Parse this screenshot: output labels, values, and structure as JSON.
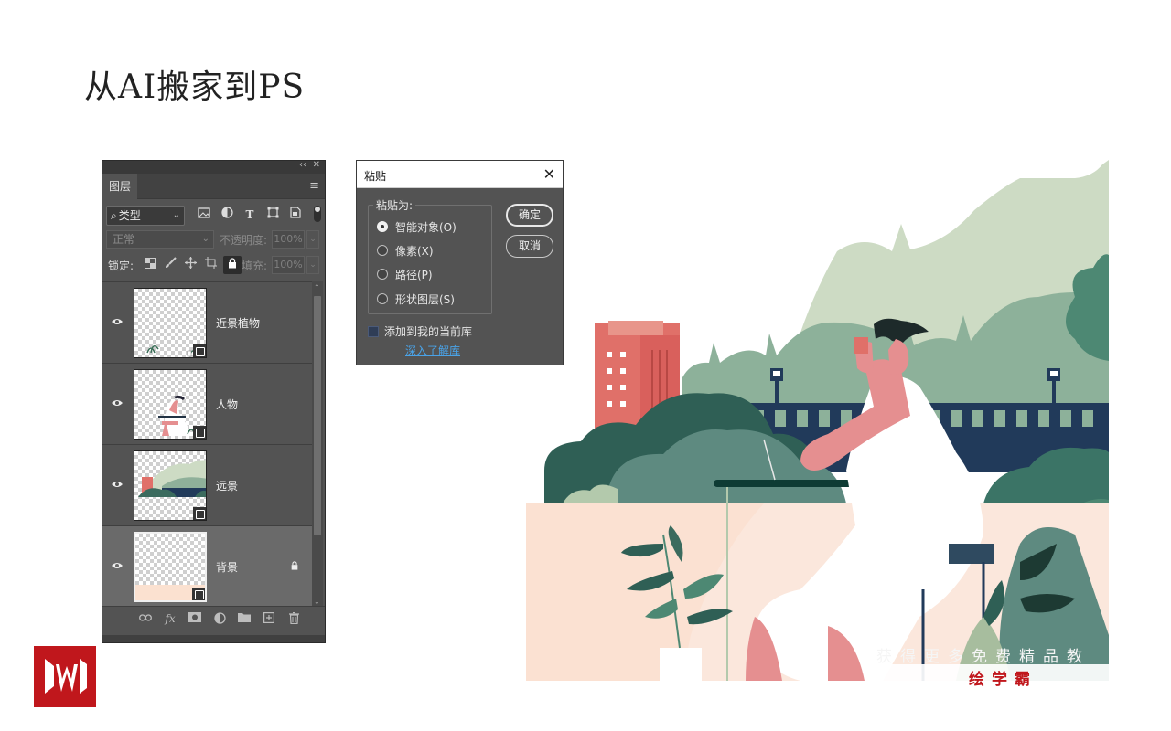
{
  "slide": {
    "title": "从AI搬家到PS"
  },
  "layers_panel": {
    "tab": "图层",
    "filter": {
      "label": "类型"
    },
    "blend_mode": "正常",
    "opacity": {
      "label": "不透明度:",
      "value": "100%"
    },
    "lock": {
      "label": "锁定:"
    },
    "fill": {
      "label": "填充:",
      "value": "100%"
    },
    "layers": [
      {
        "name": "近景植物",
        "visible": true,
        "locked": false,
        "selected": false
      },
      {
        "name": "人物",
        "visible": true,
        "locked": false,
        "selected": false
      },
      {
        "name": "远景",
        "visible": true,
        "locked": false,
        "selected": false
      },
      {
        "name": "背景",
        "visible": true,
        "locked": true,
        "selected": true
      }
    ],
    "bottom_icons": [
      "link-icon",
      "fx-icon",
      "mask-icon",
      "adjustment-icon",
      "folder-icon",
      "new-layer-icon",
      "trash-icon"
    ]
  },
  "paste_dialog": {
    "title": "粘贴",
    "group_label": "粘贴为:",
    "options": [
      {
        "label": "智能对象(O)",
        "checked": true
      },
      {
        "label": "像素(X)",
        "checked": false
      },
      {
        "label": "路径(P)",
        "checked": false
      },
      {
        "label": "形状图层(S)",
        "checked": false
      }
    ],
    "ok_label": "确定",
    "cancel_label": "取消",
    "checkbox_label": "添加到我的当前库",
    "link_label": "深入了解库"
  },
  "watermark": {
    "text": "获得更多免费精品教",
    "brand": "绘学霸"
  },
  "colors": {
    "panel_bg": "#535353",
    "accent_link": "#4aa3e8",
    "brand_red": "#c0171c",
    "sky_green": "#cddbc4",
    "navy": "#213a5a",
    "salmon": "#e07069",
    "cream": "#fbe7dc"
  }
}
